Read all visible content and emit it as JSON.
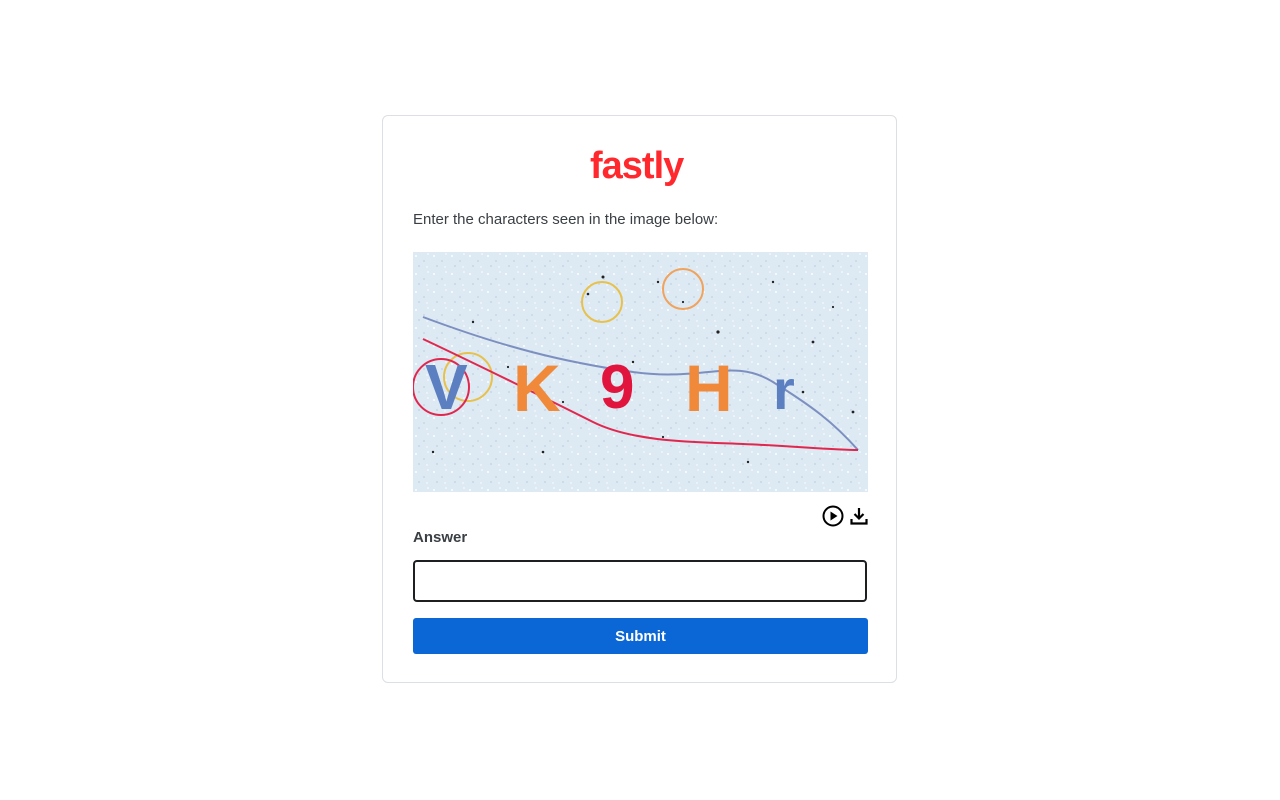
{
  "brand": {
    "logo_text": "fastly",
    "color": "#ff282d"
  },
  "captcha": {
    "instruction": "Enter the characters seen in the image below:",
    "characters": [
      "V",
      "K",
      "9",
      "H",
      "r"
    ],
    "audio_icon": "play-circle-icon",
    "download_icon": "download-icon"
  },
  "form": {
    "answer_label": "Answer",
    "answer_value": "",
    "submit_label": "Submit"
  },
  "colors": {
    "accent": "#0b66d6",
    "border": "#dcdfe3"
  }
}
